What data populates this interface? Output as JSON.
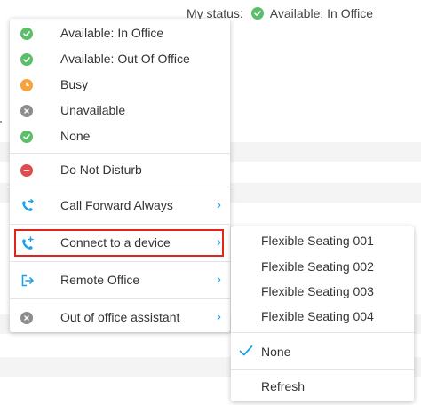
{
  "status_bar": {
    "label": "My status:",
    "value": "Available: In Office",
    "icon": "green-check-icon",
    "color": "#5bbf6a"
  },
  "menu": {
    "items": [
      {
        "label": "Available: In Office",
        "icon": "green-check-icon"
      },
      {
        "label": "Available: Out Of Office",
        "icon": "green-check-icon"
      },
      {
        "label": "Busy",
        "icon": "orange-clock-icon"
      },
      {
        "label": "Unavailable",
        "icon": "grey-x-icon"
      },
      {
        "label": "None",
        "icon": "green-check-icon"
      },
      {
        "label": "Do Not Disturb",
        "icon": "red-minus-icon"
      },
      {
        "label": "Call Forward Always",
        "icon": "call-forward-icon",
        "has_submenu": true
      },
      {
        "label": "Connect to a device",
        "icon": "connect-device-icon",
        "has_submenu": true,
        "highlighted": true
      },
      {
        "label": "Remote Office",
        "icon": "remote-office-icon",
        "has_submenu": true
      },
      {
        "label": "Out of office assistant",
        "icon": "grey-x-icon",
        "has_submenu": true
      }
    ]
  },
  "submenu": {
    "items": [
      {
        "label": "Flexible Seating 001"
      },
      {
        "label": "Flexible Seating 002"
      },
      {
        "label": "Flexible Seating 003"
      },
      {
        "label": "Flexible Seating 004"
      },
      {
        "label": "None",
        "checked": true
      },
      {
        "label": "Refresh"
      }
    ]
  },
  "colors": {
    "accent": "#1e9fe8",
    "green": "#5bbf6a",
    "orange": "#f5a33a",
    "grey": "#8c8c8c",
    "red": "#e04b4b",
    "highlight": "#e1251b"
  }
}
